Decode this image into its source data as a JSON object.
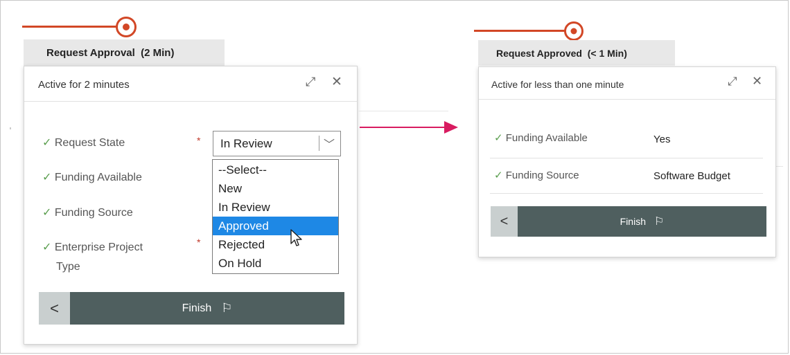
{
  "left_panel": {
    "stage_title": "Request Approval  (2 Min)",
    "active_text": "Active for 2 minutes",
    "fields": [
      {
        "label": "Request State",
        "required": "*"
      },
      {
        "label": "Funding Available"
      },
      {
        "label": "Funding Source"
      },
      {
        "label": "Enterprise Project Type",
        "label_line1": "Enterprise Project",
        "label_line2": "Type",
        "required": "*"
      }
    ],
    "select_value": "In Review",
    "dropdown_options": [
      "--Select--",
      "New",
      "In Review",
      "Approved",
      "Rejected",
      "On Hold"
    ],
    "highlighted_option": "Approved",
    "back_label": "<",
    "finish_label": "Finish"
  },
  "right_panel": {
    "stage_title": "Request Approved  (< 1 Min)",
    "active_text": "Active for less than one minute",
    "fields": [
      {
        "label": "Funding Available",
        "value": "Yes"
      },
      {
        "label": "Funding Source",
        "value": "Software Budget"
      }
    ],
    "back_label": "<",
    "finish_label": "Finish"
  },
  "icons": {
    "check": "✓",
    "expand": "⤢",
    "close": "✕",
    "chevron_down": "﹀",
    "flag": "⚐",
    "cursor": "pointer-cursor"
  },
  "colors": {
    "stage_accent": "#d24726",
    "finish_bar": "#4f5f5f",
    "back_button": "#c9cfcf",
    "highlight": "#1e88e5",
    "check": "#5a9e4e",
    "arrow": "#d81b60"
  }
}
